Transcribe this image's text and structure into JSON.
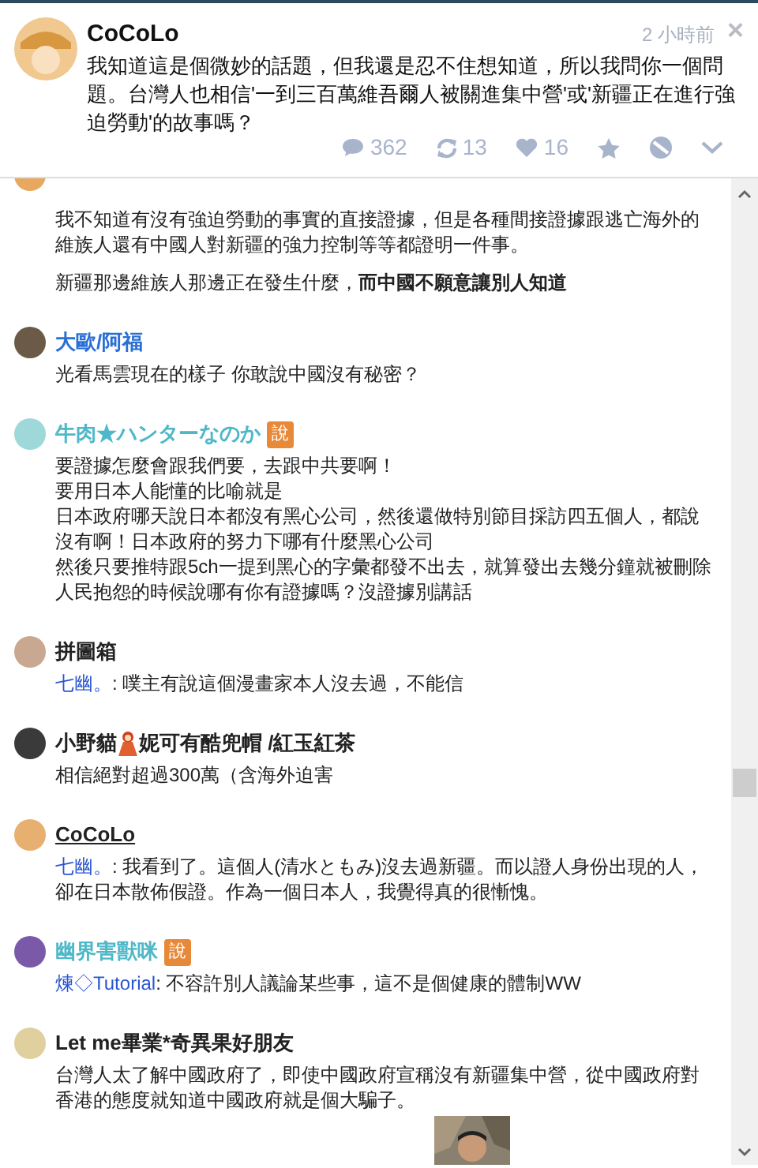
{
  "post": {
    "author": "CoCoLo",
    "time": "2 小時前",
    "close": "×",
    "text": "我知道這是個微妙的話題，但我還是忍不住想知道，所以我問你一個問題。台灣人也相信'一到三百萬維吾爾人被關進集中營'或'新疆正在進行強迫勞動'的故事嗎？",
    "responses": "362",
    "replurks": "13",
    "likes": "16"
  },
  "comments": [
    {
      "paragraph_gap": true,
      "paragraphs": [
        "我不知道有沒有強迫勞動的事實的直接證據，但是各種間接證據跟逃亡海外的維族人還有中國人對新疆的強力控制等等都證明一件事。",
        "新疆那邊維族人那邊正在發生什麼，**而中國不願意讓別人知道**"
      ]
    },
    {
      "name": "大歐/阿福",
      "color": "#2a6fd6",
      "paragraphs": [
        "光看馬雲現在的樣子 你敢說中國沒有秘密？"
      ]
    },
    {
      "name": "牛肉★ハンターなのか",
      "color": "#4fb8c8",
      "badge": "說",
      "paragraphs": [
        "要證據怎麼會跟我們要，去跟中共要啊！",
        "要用日本人能懂的比喻就是",
        "日本政府哪天說日本都沒有黑心公司，然後還做特別節目採訪四五個人，都說沒有啊！日本政府的努力下哪有什麼黑心公司",
        "然後只要推特跟5ch一提到黑心的字彙都發不出去，就算發出去幾分鐘就被刪除",
        "人民抱怨的時候說哪有你有證據嗎？沒證據別講話"
      ]
    },
    {
      "name": "拼圖箱",
      "color": "#222222",
      "mention": "七幽。",
      "paragraphs": [
        ": 噗主有說這個漫畫家本人沒去過，不能信"
      ]
    },
    {
      "name": "小野貓",
      "name_rest": "妮可有酷兜帽 /紅玉紅茶",
      "color": "#222222",
      "paragraphs": [
        "相信絕對超過300萬（含海外迫害"
      ]
    },
    {
      "name": "CoCoLo",
      "color": "#222222",
      "underlined": true,
      "mention": "七幽。",
      "paragraphs": [
        ": 我看到了。這個人(清水ともみ)沒去過新疆。而以證人身份出現的人，卻在日本散佈假證。作為一個日本人，我覺得真的很慚愧。"
      ]
    },
    {
      "name": "幽界害獸咪",
      "color": "#4fb8c8",
      "badge": "說",
      "mention": "煉◇Tutorial",
      "paragraphs": [
        ": 不容許別人議論某些事，這不是個健康的體制WW"
      ]
    },
    {
      "name": "Let me畢業*奇異果好朋友",
      "color": "#222222",
      "sticker": true,
      "paragraphs": [
        "台灣人太了解中國政府了，即使中國政府宣稱沒有新疆集中營，從中國政府對香港的態度就知道中國政府就是個大騙子。"
      ]
    }
  ]
}
